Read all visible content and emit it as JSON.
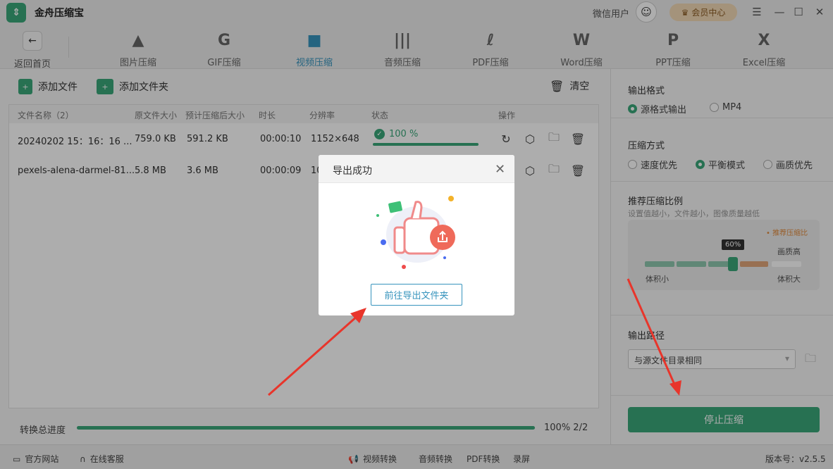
{
  "app": {
    "title": "金舟压缩宝",
    "logo_icon": "app-logo-icon"
  },
  "header": {
    "user_name": "微信用户",
    "vip_label": "会员中心",
    "back_label": "返回首页"
  },
  "tools": [
    {
      "label": "图片压缩",
      "icon": "image-compress-icon",
      "glyph": "▲"
    },
    {
      "label": "GIF压缩",
      "icon": "gif-compress-icon",
      "glyph": "G"
    },
    {
      "label": "视频压缩",
      "icon": "video-compress-icon",
      "glyph": "■"
    },
    {
      "label": "音频压缩",
      "icon": "audio-compress-icon",
      "glyph": "|||"
    },
    {
      "label": "PDF压缩",
      "icon": "pdf-compress-icon",
      "glyph": "ℓ"
    },
    {
      "label": "Word压缩",
      "icon": "word-compress-icon",
      "glyph": "W"
    },
    {
      "label": "PPT压缩",
      "icon": "ppt-compress-icon",
      "glyph": "P"
    },
    {
      "label": "Excel压缩",
      "icon": "excel-compress-icon",
      "glyph": "X"
    }
  ],
  "actions": {
    "add_file": "添加文件",
    "add_folder": "添加文件夹",
    "clear": "清空"
  },
  "table": {
    "headers": [
      "文件名称（2）",
      "原文件大小",
      "预计压缩后大小",
      "时长",
      "分辨率",
      "状态",
      "操作"
    ],
    "rows": [
      {
        "name": "20240202 15：16：16 ...",
        "orig": "759.0 KB",
        "est": "591.2 KB",
        "dur": "00:00:10",
        "res": "1152×648",
        "status": "100 %",
        "progress": 1.0
      },
      {
        "name": "pexels-alena-darmel-81...",
        "orig": "5.8 MB",
        "est": "3.6 MB",
        "dur": "00:00:09",
        "res": "10"
      }
    ]
  },
  "progress": {
    "label": "转换总进度",
    "value_text": "100% 2/2",
    "fraction": 1.0
  },
  "right": {
    "format_title": "输出格式",
    "format_options": [
      "源格式输出",
      "MP4"
    ],
    "method_title": "压缩方式",
    "method_options": [
      "速度优先",
      "平衡模式",
      "画质优先"
    ],
    "ratio_title": "推荐压缩比例",
    "ratio_hint": "设置值越小，文件越小，图像质量越低",
    "ratio_recommend": "• 推荐压缩比",
    "ratio_value": "60%",
    "ratio_quality_label": "画质高",
    "ratio_small": "体积小",
    "ratio_big": "体积大",
    "output_title": "输出路径",
    "output_value": "与源文件目录相同",
    "start_label": "停止压缩"
  },
  "bottom": {
    "website": "官方网站",
    "service": "在线客服",
    "links": [
      "视频转换",
      "音频转换",
      "PDF转换",
      "录屏"
    ],
    "version": "版本号：v2.5.5"
  },
  "dialog": {
    "title": "导出成功",
    "button": "前往导出文件夹"
  },
  "colors": {
    "accent": "#3aa77a",
    "active": "#3794bd",
    "arrow": "#e8352b"
  }
}
